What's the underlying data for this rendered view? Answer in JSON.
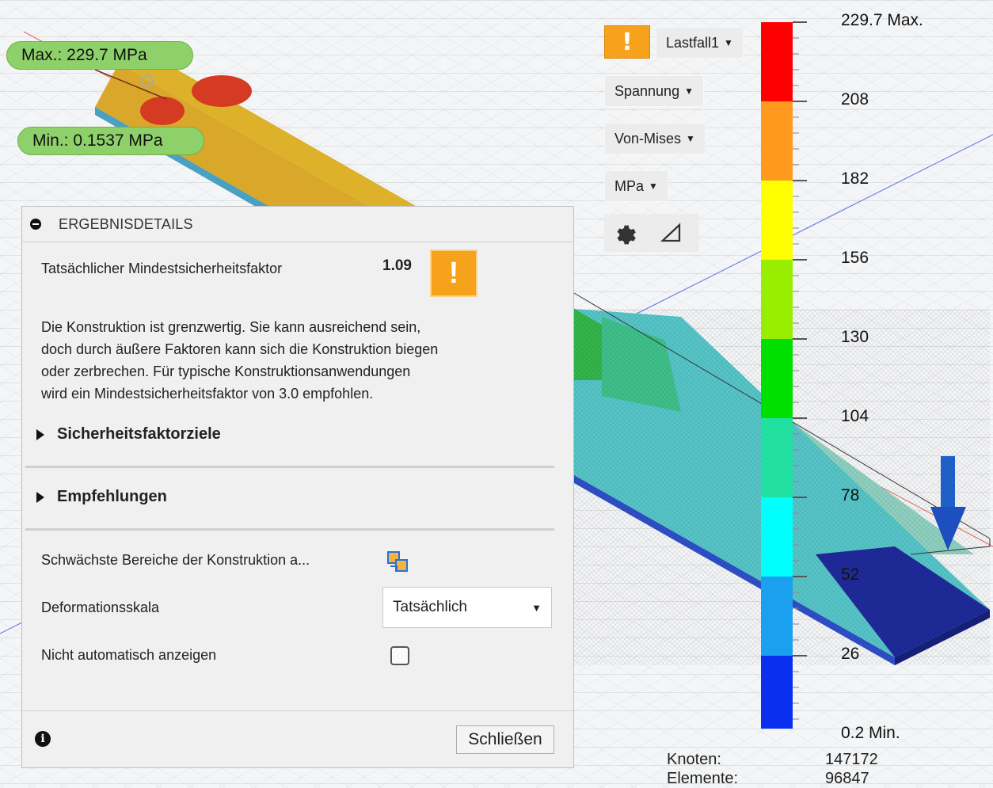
{
  "viewport": {
    "max_callout": "Max.: 229.7 MPa",
    "min_callout": "Min.: 0.1537 MPa"
  },
  "toolbar": {
    "warning_icon": "warning-icon",
    "warning_glyph": "!",
    "loadcase": "Lastfall1",
    "result_type": "Spannung",
    "stress_type": "Von-Mises",
    "unit": "MPa",
    "settings_icon": "gear-icon",
    "probe_icon": "triangle-icon"
  },
  "legend": {
    "labels": [
      "229.7 Max.",
      "208",
      "182",
      "156",
      "130",
      "104",
      "78",
      "52",
      "26",
      "0.2 Min."
    ],
    "colors": [
      "#ff0000",
      "#ff9a1e",
      "#ffff00",
      "#99ee00",
      "#00e000",
      "#22e0a0",
      "#00ffff",
      "#1aa0ee",
      "#0a2ff0"
    ]
  },
  "stats": {
    "nodes_label": "Knoten:",
    "nodes_value": "147172",
    "elements_label": "Elemente:",
    "elements_value": "96847"
  },
  "panel": {
    "title": "ERGEBNISDETAILS",
    "sf_label": "Tatsächlicher Mindestsicherheitsfaktor",
    "sf_value": "1.09",
    "warning_glyph": "!",
    "description": [
      "Die Konstruktion ist grenzwertig. Sie kann ausreichend sein,",
      "doch durch äußere Faktoren kann sich die Konstruktion biegen",
      "oder zerbrechen. Für typische Konstruktionsanwendungen",
      "wird ein Mindestsicherheitsfaktor von 3.0 empfohlen."
    ],
    "section_targets": "Sicherheitsfaktorziele",
    "section_recommendations": "Empfehlungen",
    "weak_areas_label": "Schwächste Bereiche der Konstruktion a...",
    "deformation_label": "Deformationsskala",
    "deformation_value": "Tatsächlich",
    "no_auto_label": "Nicht automatisch anzeigen",
    "close_label": "Schließen"
  }
}
